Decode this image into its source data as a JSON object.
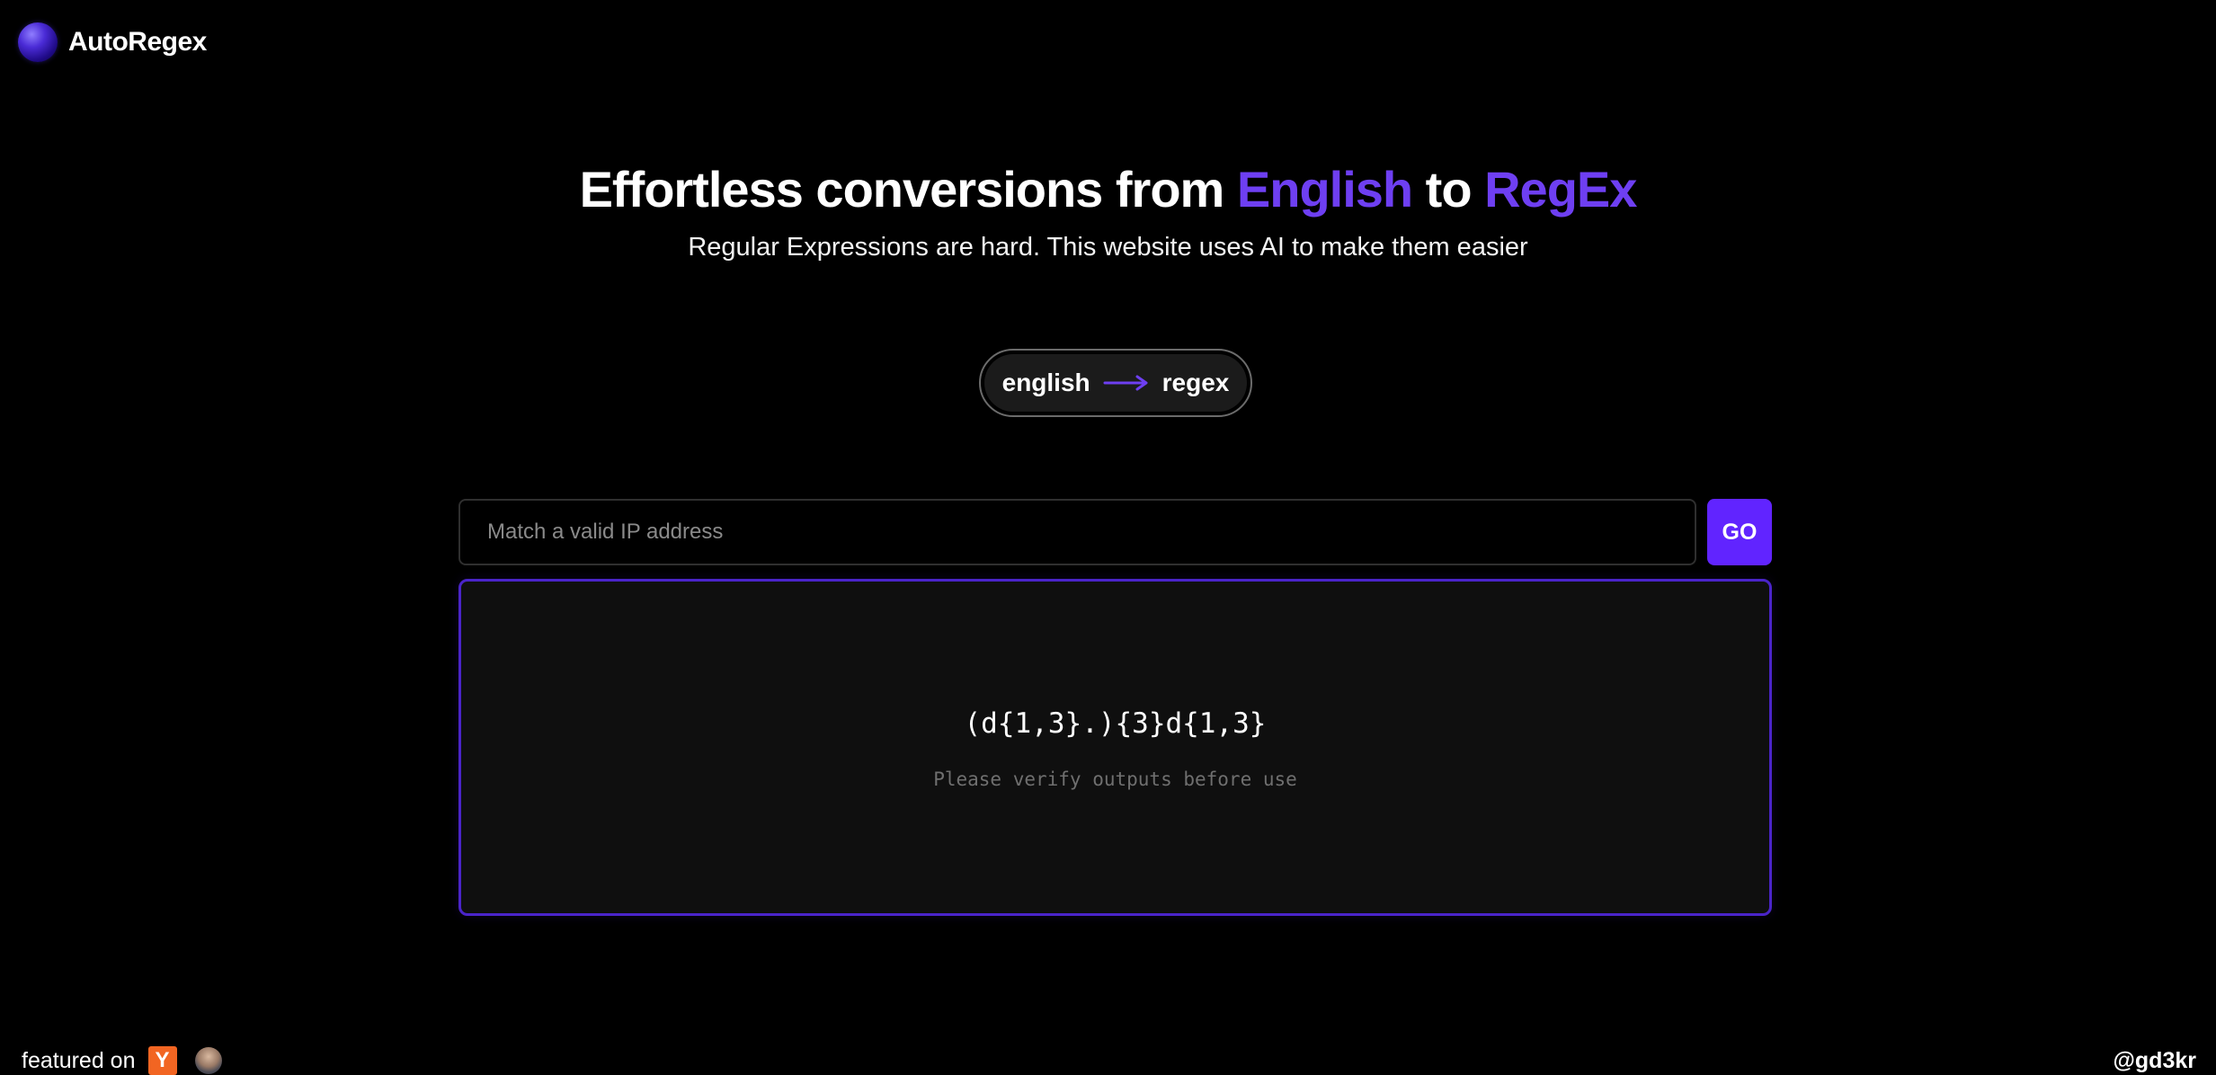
{
  "header": {
    "logo_text": "AutoRegex"
  },
  "hero": {
    "title_part1": "Effortless conversions from ",
    "title_accent1": "English",
    "title_part2": " to ",
    "title_accent2": "RegEx",
    "subtitle": "Regular Expressions are hard. This website uses AI to make them easier"
  },
  "mode_toggle": {
    "from_label": "english",
    "to_label": "regex",
    "arrow_icon": "long-arrow-right-icon"
  },
  "prompt": {
    "value": "",
    "placeholder": "Match a valid IP address",
    "go_label": "GO"
  },
  "output": {
    "regex": "(d{1,3}.){3}d{1,3}",
    "note": "Please verify outputs before use"
  },
  "footer": {
    "featured_label": "featured on",
    "yc_icon_glyph": "Y",
    "handle": "@gd3kr"
  },
  "colors": {
    "background": "#000000",
    "accent": "#6e3ff2",
    "button": "#6124ff",
    "panel_border": "#4a24c9",
    "panel_background": "#0f0f0f",
    "muted_text": "#6f6f6f",
    "yc_orange": "#f26522"
  }
}
